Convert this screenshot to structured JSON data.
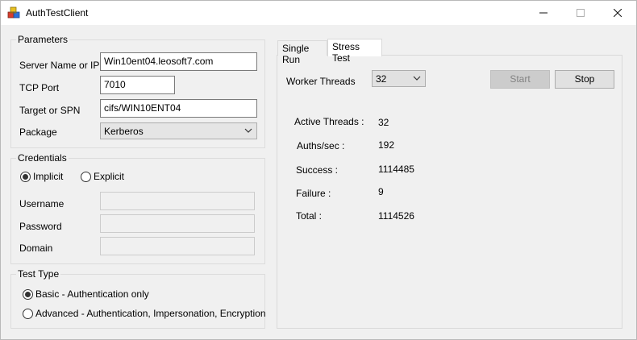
{
  "window": {
    "title": "AuthTestClient",
    "icons": {
      "app": "app-cubes-icon",
      "minimize": "minimize-icon",
      "maximize": "maximize-icon",
      "close": "close-icon"
    }
  },
  "parameters": {
    "title": "Parameters",
    "server_label": "Server Name or IP",
    "server_value": "Win10ent04.leosoft7.com",
    "port_label": "TCP Port",
    "port_value": "7010",
    "spn_label": "Target or SPN",
    "spn_value": "cifs/WIN10ENT04",
    "package_label": "Package",
    "package_value": "Kerberos"
  },
  "credentials": {
    "title": "Credentials",
    "implicit_label": "Implicit",
    "implicit_selected": true,
    "explicit_label": "Explicit",
    "explicit_selected": false,
    "username_label": "Username",
    "username_value": "",
    "password_label": "Password",
    "password_value": "",
    "domain_label": "Domain",
    "domain_value": ""
  },
  "test_type": {
    "title": "Test Type",
    "basic_label": "Basic - Authentication only",
    "basic_selected": true,
    "advanced_label": "Advanced - Authentication, Impersonation, Encryption",
    "advanced_selected": false
  },
  "tabs": [
    {
      "label": "Single Run",
      "active": false
    },
    {
      "label": "Stress Test",
      "active": true
    }
  ],
  "stress": {
    "worker_threads_label": "Worker Threads",
    "worker_threads_value": "32",
    "start_label": "Start",
    "start_enabled": false,
    "stop_label": "Stop",
    "stop_enabled": true,
    "active_threads_label": "Active Threads :",
    "active_threads_value": "32",
    "auths_label": "Auths/sec :",
    "auths_value": "192",
    "success_label": "Success :",
    "success_value": "1114485",
    "failure_label": "Failure :",
    "failure_value": "9",
    "total_label": "Total :",
    "total_value": "1114526"
  }
}
